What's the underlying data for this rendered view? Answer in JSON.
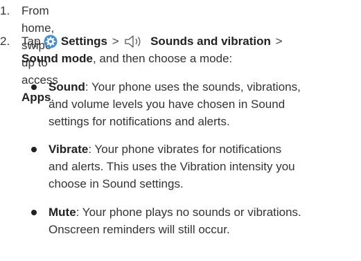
{
  "steps": [
    {
      "number": "1.",
      "text": "From home, swipe up to access ",
      "bold": "Apps",
      "end": "."
    },
    {
      "number": "2.",
      "prefix": "Tap",
      "settings_label": "Settings",
      "separator": ">",
      "sounds_label": "Sounds and vibration",
      "sound_mode_label": "Sound mode",
      "suffix": ", and then choose a mode:",
      "icons": {
        "settings": "settings-gear-icon",
        "sounds": "speaker-volume-icon"
      },
      "accent_color": "#3e8ed8"
    }
  ],
  "modes": [
    {
      "name": "Sound",
      "lines": [
        ": Your phone uses the sounds, vibrations,",
        "and volume levels you have chosen in Sound",
        "settings for notifications and alerts."
      ]
    },
    {
      "name": "Vibrate",
      "lines": [
        ": Your phone vibrates for notifications",
        "and alerts. This uses the Vibration intensity you",
        "choose in Sound settings."
      ]
    },
    {
      "name": "Mute",
      "lines": [
        ": Your phone plays no sounds or vibrations.",
        "Onscreen reminders will still occur."
      ]
    }
  ]
}
